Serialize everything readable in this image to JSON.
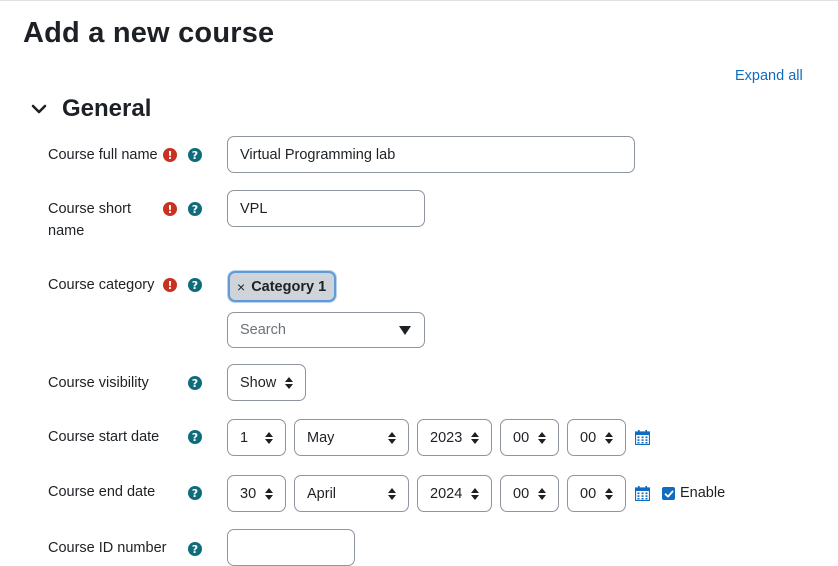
{
  "page": {
    "title": "Add a new course",
    "expand_all": "Expand all"
  },
  "section": {
    "title": "General"
  },
  "fields": {
    "full_name": {
      "label": "Course full name",
      "value": "Virtual Programming lab"
    },
    "short_name": {
      "label_line1": "Course short",
      "label_line2": "name",
      "value": "VPL"
    },
    "category": {
      "label": "Course category",
      "selected_tag": "Category 1",
      "remove_glyph": "×",
      "search_placeholder": "Search"
    },
    "visibility": {
      "label": "Course visibility",
      "value": "Show"
    },
    "start_date": {
      "label": "Course start date",
      "day": "1",
      "month": "May",
      "year": "2023",
      "hour": "00",
      "minute": "00"
    },
    "end_date": {
      "label": "Course end date",
      "day": "30",
      "month": "April",
      "year": "2024",
      "hour": "00",
      "minute": "00",
      "enable_label": "Enable",
      "enabled": true
    },
    "id_number": {
      "label": "Course ID number",
      "value": ""
    }
  },
  "icons": {
    "required": "exclamation-circle-icon",
    "help": "question-circle-icon",
    "calendar": "calendar-icon",
    "collapse": "chevron-down-icon"
  },
  "colors": {
    "link": "#0f6cbf",
    "required": "#ca3120",
    "help": "#0f6c7a",
    "tag_border": "#5f9bd6"
  }
}
